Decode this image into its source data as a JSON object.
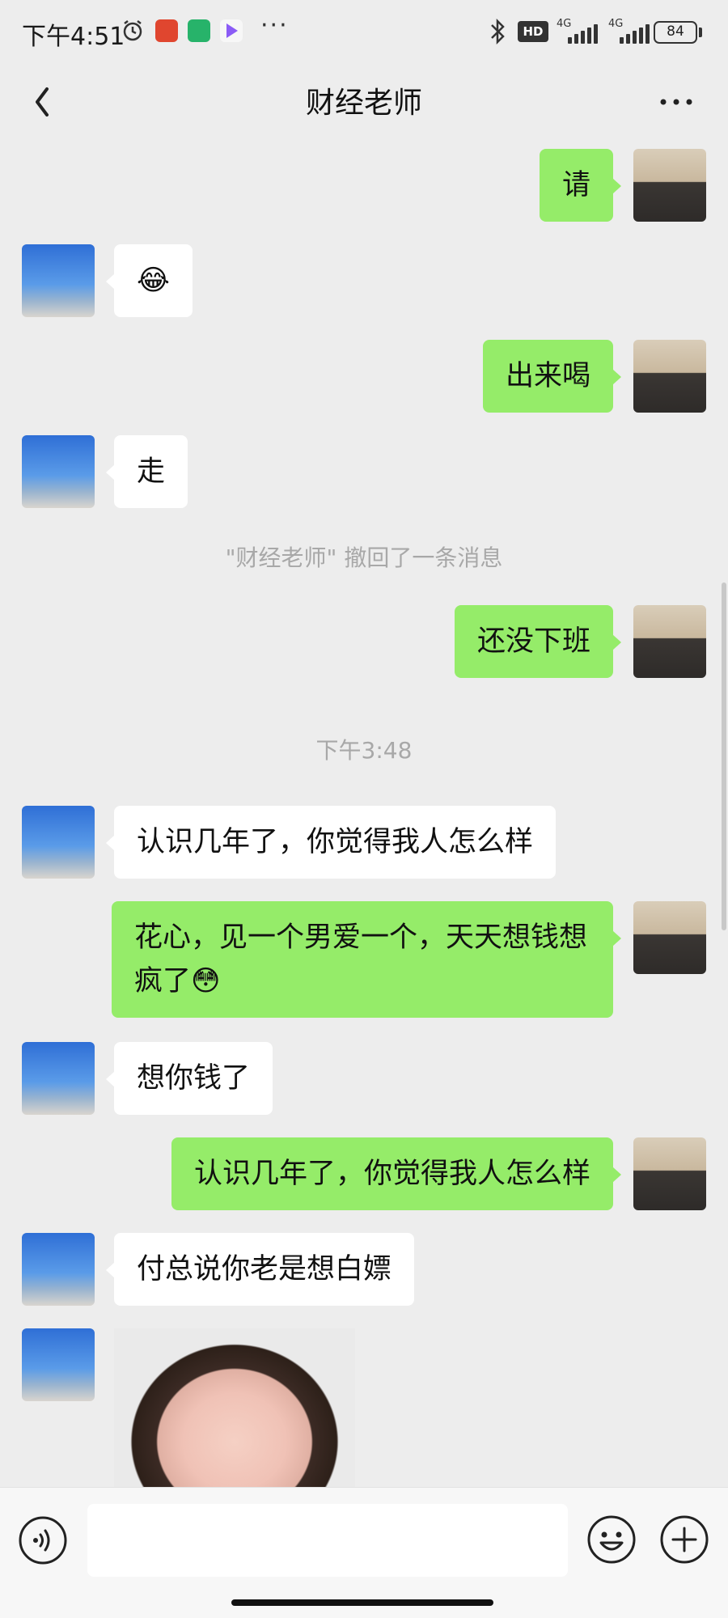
{
  "status_bar": {
    "time": "下午4:51",
    "more": "···",
    "hd": "HD",
    "network1": "4G",
    "network2": "4G",
    "battery": "84"
  },
  "header": {
    "title": "财经老师"
  },
  "messages": [
    {
      "side": "right",
      "text": "请"
    },
    {
      "side": "left",
      "text": "😂"
    },
    {
      "side": "right",
      "text": "出来喝"
    },
    {
      "side": "left",
      "text": "走"
    },
    {
      "system": "\"财经老师\" 撤回了一条消息"
    },
    {
      "side": "right",
      "text": "还没下班"
    },
    {
      "timestamp": "下午3:48"
    },
    {
      "side": "left",
      "text": "认识几年了，你觉得我人怎么样"
    },
    {
      "side": "right",
      "text": "花心，见一个男爱一个，天天想钱想疯了😳"
    },
    {
      "side": "left",
      "text": "想你钱了"
    },
    {
      "side": "right",
      "text": "认识几年了，你觉得我人怎么样"
    },
    {
      "side": "left",
      "text": "付总说你老是想白嫖"
    },
    {
      "side": "left",
      "sticker": "laughing-child-sticker"
    }
  ],
  "input_bar": {
    "placeholder": ""
  },
  "colors": {
    "background": "#ededed",
    "bubble_self": "#95ec69",
    "bubble_other": "#ffffff",
    "system_text": "#a8a8a8"
  }
}
